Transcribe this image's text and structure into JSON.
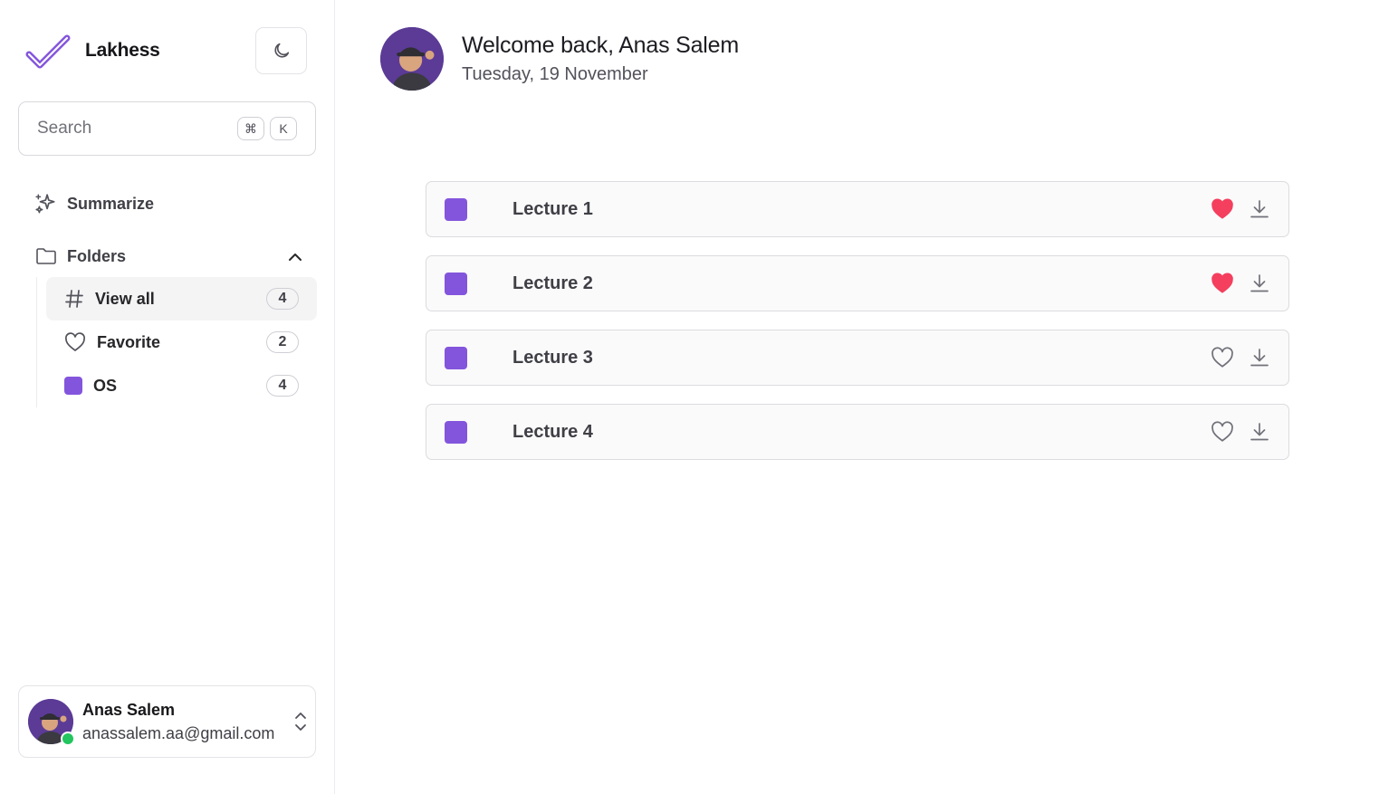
{
  "app": {
    "name": "Lakhess"
  },
  "search": {
    "placeholder": "Search",
    "shortcut_key1": "⌘",
    "shortcut_key2": "K"
  },
  "nav": {
    "summarize_label": "Summarize",
    "folders_label": "Folders"
  },
  "folders": [
    {
      "label": "View all",
      "count": "4",
      "icon": "hash-icon",
      "active": true
    },
    {
      "label": "Favorite",
      "count": "2",
      "icon": "heart-icon",
      "active": false
    },
    {
      "label": "OS",
      "count": "4",
      "icon": "color-swatch",
      "active": false
    }
  ],
  "user": {
    "name": "Anas Salem",
    "email": "anassalem.aa@gmail.com",
    "status": "online"
  },
  "header": {
    "welcome": "Welcome back, Anas Salem",
    "date": "Tuesday, 19 November"
  },
  "lectures": [
    {
      "title": "Lecture 1",
      "favorite": true
    },
    {
      "title": "Lecture 2",
      "favorite": true
    },
    {
      "title": "Lecture 3",
      "favorite": false
    },
    {
      "title": "Lecture 4",
      "favorite": false
    }
  ],
  "colors": {
    "accent": "#8355dc",
    "heart_active": "#f43f5e",
    "online": "#22c55e",
    "avatar_bg": "#5b3b96"
  }
}
